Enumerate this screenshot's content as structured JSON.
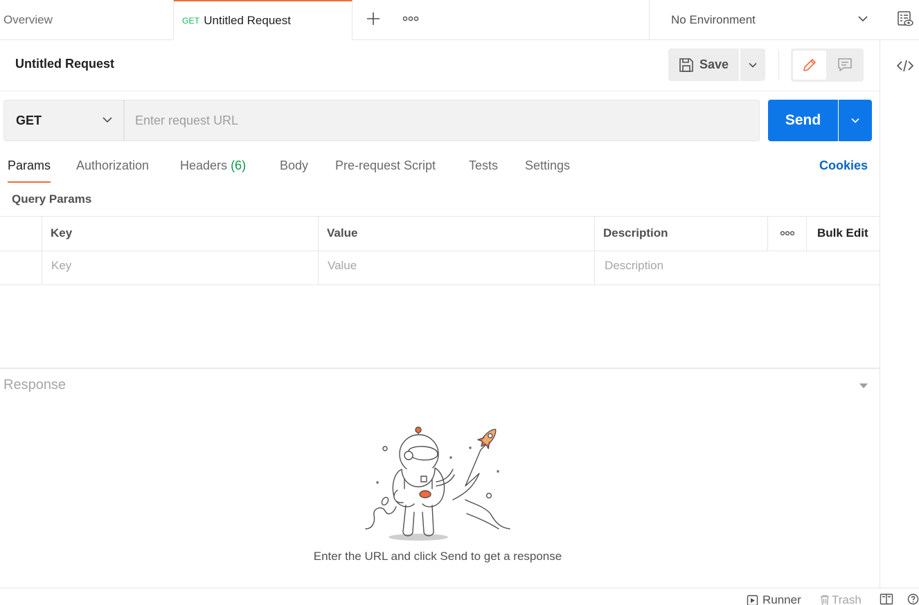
{
  "tabs": {
    "overview_label": "Overview",
    "active": {
      "method": "GET",
      "title": "Untitled Request"
    },
    "environment": "No Environment"
  },
  "request": {
    "title": "Untitled Request",
    "save_label": "Save",
    "method": "GET",
    "url_placeholder": "Enter request URL",
    "url_value": "",
    "send_label": "Send"
  },
  "request_tabs": [
    {
      "label": "Params",
      "active": true
    },
    {
      "label": "Authorization"
    },
    {
      "label": "Headers",
      "count": "(6)"
    },
    {
      "label": "Body"
    },
    {
      "label": "Pre-request Script"
    },
    {
      "label": "Tests"
    },
    {
      "label": "Settings"
    }
  ],
  "cookies_label": "Cookies",
  "query_params": {
    "title": "Query Params",
    "columns": [
      "Key",
      "Value",
      "Description"
    ],
    "bulk_edit_label": "Bulk Edit",
    "row_placeholders": [
      "Key",
      "Value",
      "Description"
    ]
  },
  "response": {
    "title": "Response",
    "empty_hint": "Enter the URL and click Send to get a response"
  },
  "status_bar": {
    "runner_label": "Runner",
    "trash_label": "Trash"
  },
  "colors": {
    "accent": "#f26b3a",
    "send_blue": "#0d77ea",
    "get_green": "#0cbb52",
    "cookies_blue": "#0b65c2"
  },
  "icons": [
    "plus-icon",
    "more-horizontal-icon",
    "chevron-down-icon",
    "environment-eye-icon",
    "code-icon",
    "save-icon",
    "pencil-icon",
    "comment-icon",
    "caret-down-icon",
    "runner-icon",
    "trash-icon",
    "two-pane-icon",
    "help-icon"
  ]
}
